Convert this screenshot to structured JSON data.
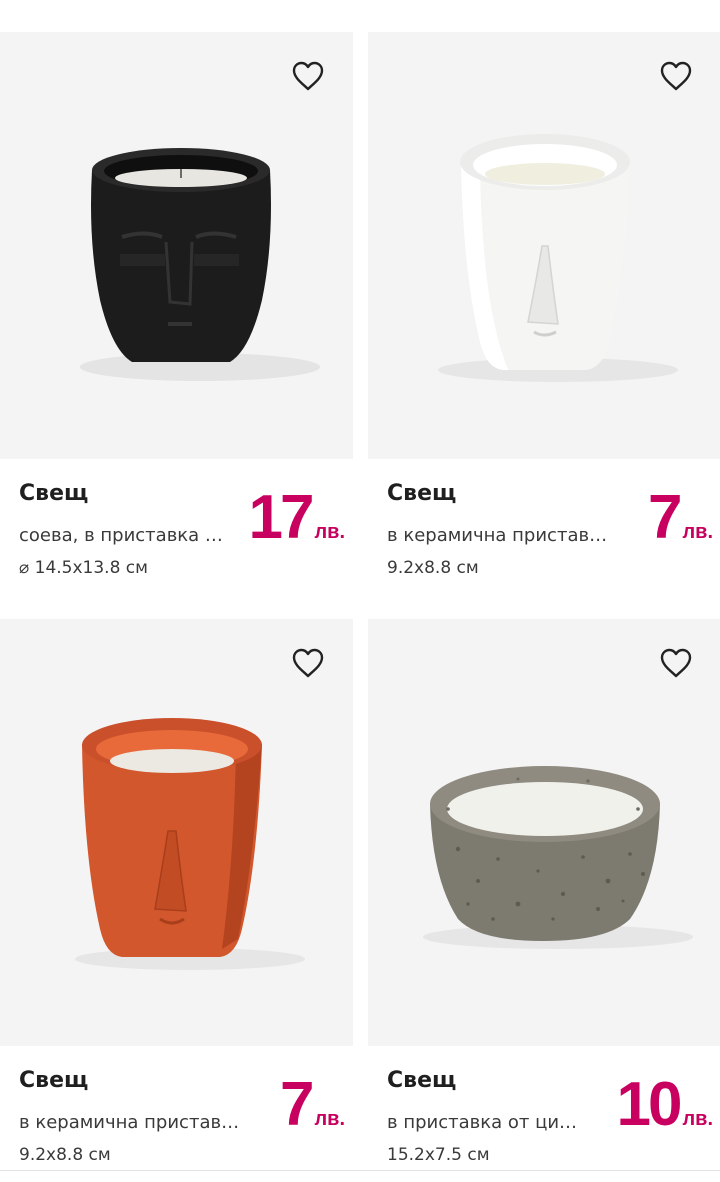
{
  "products": [
    {
      "title": "Свещ",
      "description": "соева, в приставка …",
      "dimensions": "⌀ 14.5x13.8 см",
      "price": "17",
      "currency": "лв.",
      "image_icon": "black-face-candle-image"
    },
    {
      "title": "Свещ",
      "description": "в керамична приставк…",
      "dimensions": "9.2x8.8 см",
      "price": "7",
      "currency": "лв.",
      "image_icon": "white-face-candle-image"
    },
    {
      "title": "Свещ",
      "description": "в керамична приставк…",
      "dimensions": "9.2x8.8 см",
      "price": "7",
      "currency": "лв.",
      "image_icon": "orange-face-candle-image"
    },
    {
      "title": "Свещ",
      "description": "в приставка от ци…",
      "dimensions": "15.2x7.5 см",
      "price": "10",
      "currency": "лв.",
      "image_icon": "cement-bowl-candle-image"
    }
  ],
  "colors": {
    "price": "#c8005f",
    "image_background": "#f4f4f4"
  },
  "icons": {
    "favorite": "heart-outline-icon"
  }
}
